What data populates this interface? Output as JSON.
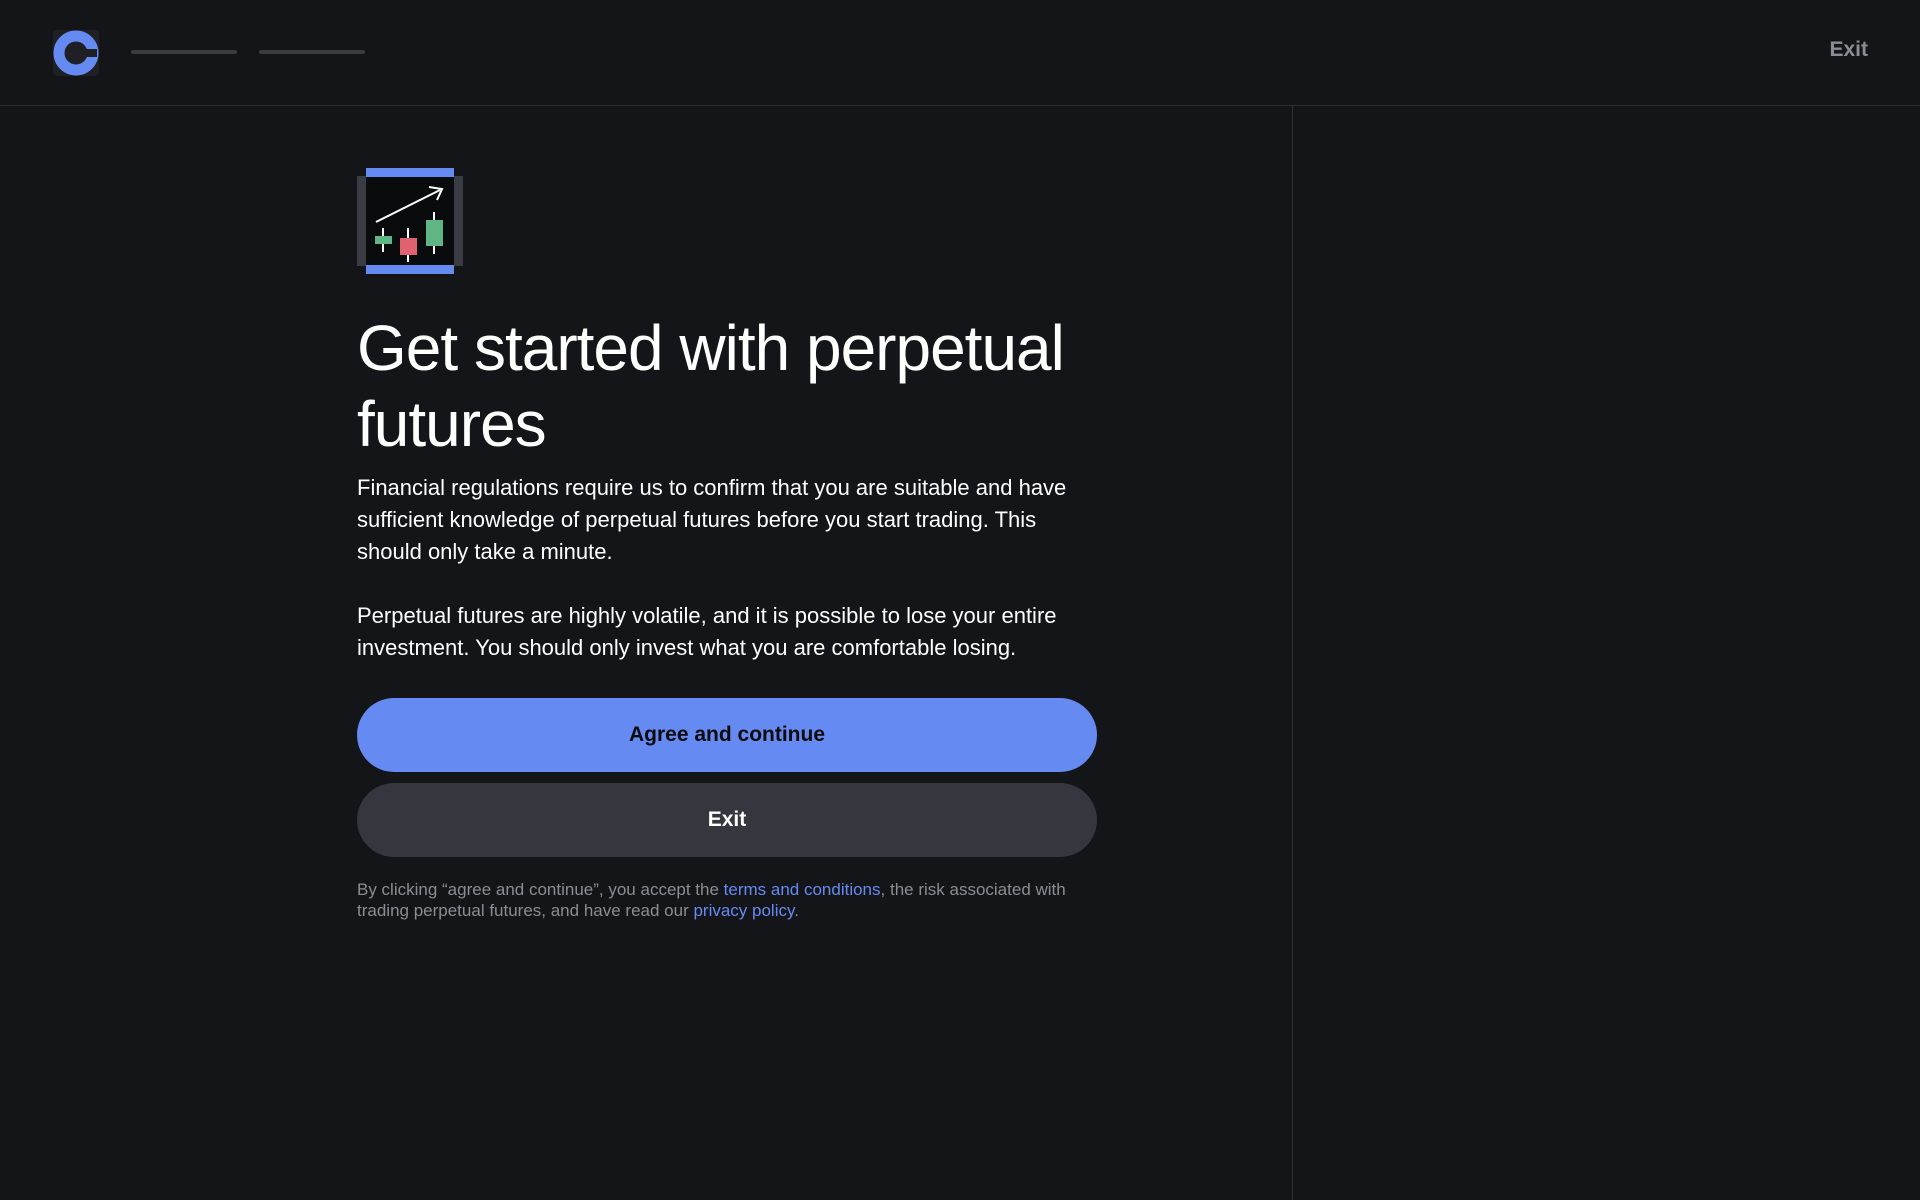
{
  "colors": {
    "background": "#141519",
    "accent": "#658af1",
    "secondary_button": "#36363e",
    "muted_text": "#8a8d94",
    "candle_green": "#5fb584",
    "candle_red": "#e0626f"
  },
  "header": {
    "logo_icon": "coinbase-logo-icon",
    "progress_steps": 2,
    "exit_label": "Exit"
  },
  "main": {
    "illustration_icon": "candlestick-chart-icon",
    "title": "Get started with perpetual futures",
    "paragraph_1": "Financial regulations require us to confirm that you are suitable and have sufficient knowledge of perpetual futures before you start trading. This should only take a minute.",
    "paragraph_2": "Perpetual futures are highly volatile, and it is possible to lose your entire investment. You should only invest what you are comfortable losing.",
    "primary_button": "Agree and continue",
    "secondary_button": "Exit",
    "disclaimer": {
      "prefix": "By clicking “agree and continue”, you accept the ",
      "terms_link": "terms and conditions",
      "middle": ", the risk associated with trading perpetual futures, and have read our ",
      "privacy_link": "privacy policy",
      "suffix": "."
    }
  }
}
